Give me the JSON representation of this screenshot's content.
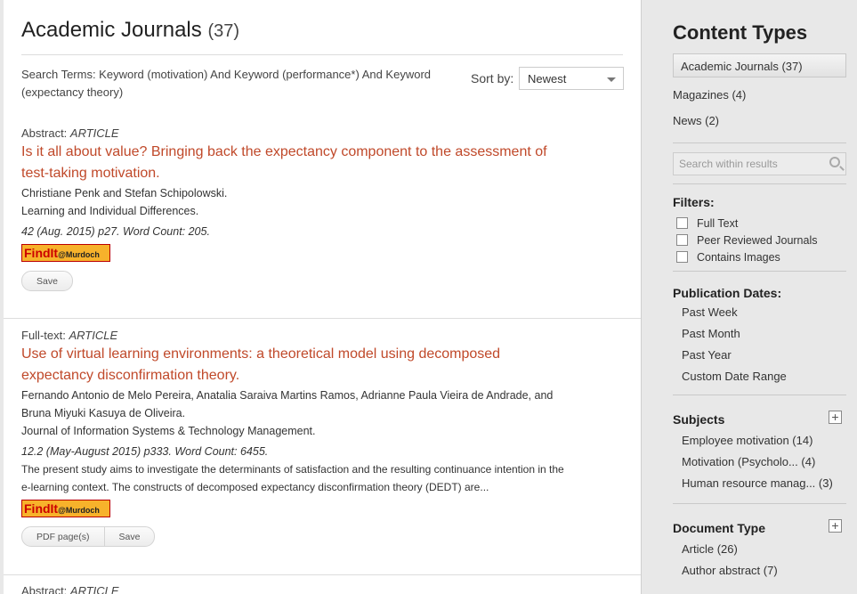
{
  "main": {
    "title": "Academic Journals",
    "count": "(37)",
    "search_terms": "Search Terms: Keyword (motivation) And Keyword (performance*) And Keyword (expectancy theory)",
    "sort_label": "Sort by:",
    "sort_value": "Newest"
  },
  "results": [
    {
      "type_prefix": "Abstract: ",
      "type_label": "ARTICLE",
      "title": "Is it all about value? Bringing back the expectancy component to the assessment of test-taking motivation.",
      "authors": "Christiane Penk and Stefan Schipolowski.",
      "journal": "Learning and Individual Differences.",
      "meta": "42 (Aug. 2015)  p27.  Word Count: 205.",
      "findit_main": "FindIt",
      "findit_suffix": "@Murdoch",
      "buttons": [
        "Save"
      ]
    },
    {
      "type_prefix": "Full-text: ",
      "type_label": "ARTICLE",
      "title": "Use of virtual learning environments: a theoretical model using decomposed expectancy disconfirmation theory.",
      "authors": "Fernando Antonio de Melo Pereira, Anatalia Saraiva Martins Ramos, Adrianne Paula Vieira de Andrade, and Bruna Miyuki Kasuya de Oliveira.",
      "journal": "Journal of Information Systems & Technology Management.",
      "meta": "12.2 (May-August 2015)  p333.  Word Count: 6455.",
      "abstract": "The present study aims to investigate the determinants of satisfaction and the resulting continuance intention in the e-learning context. The constructs of decomposed expectancy disconfirmation theory (DEDT) are...",
      "findit_main": "FindIt",
      "findit_suffix": "@Murdoch",
      "buttons": [
        "PDF page(s)",
        "Save"
      ]
    },
    {
      "type_prefix": "Abstract: ",
      "type_label": "ARTICLE"
    }
  ],
  "sidebar": {
    "title": "Content Types",
    "content_types": [
      {
        "label": "Academic Journals (37)",
        "active": true
      },
      {
        "label": "Magazines (4)"
      },
      {
        "label": "News (2)"
      }
    ],
    "search_placeholder": "Search within results",
    "filters_heading": "Filters:",
    "filters": [
      "Full Text",
      "Peer Reviewed Journals",
      "Contains Images"
    ],
    "pubdates_heading": "Publication Dates:",
    "pubdates": [
      "Past Week",
      "Past Month",
      "Past Year",
      "Custom Date Range"
    ],
    "subjects_heading": "Subjects",
    "subjects": [
      "Employee motivation (14)",
      "Motivation (Psycholo...  (4)",
      "Human resource manag...  (3)"
    ],
    "doctype_heading": "Document Type",
    "doctypes": [
      "Article (26)",
      "Author abstract (7)"
    ]
  }
}
